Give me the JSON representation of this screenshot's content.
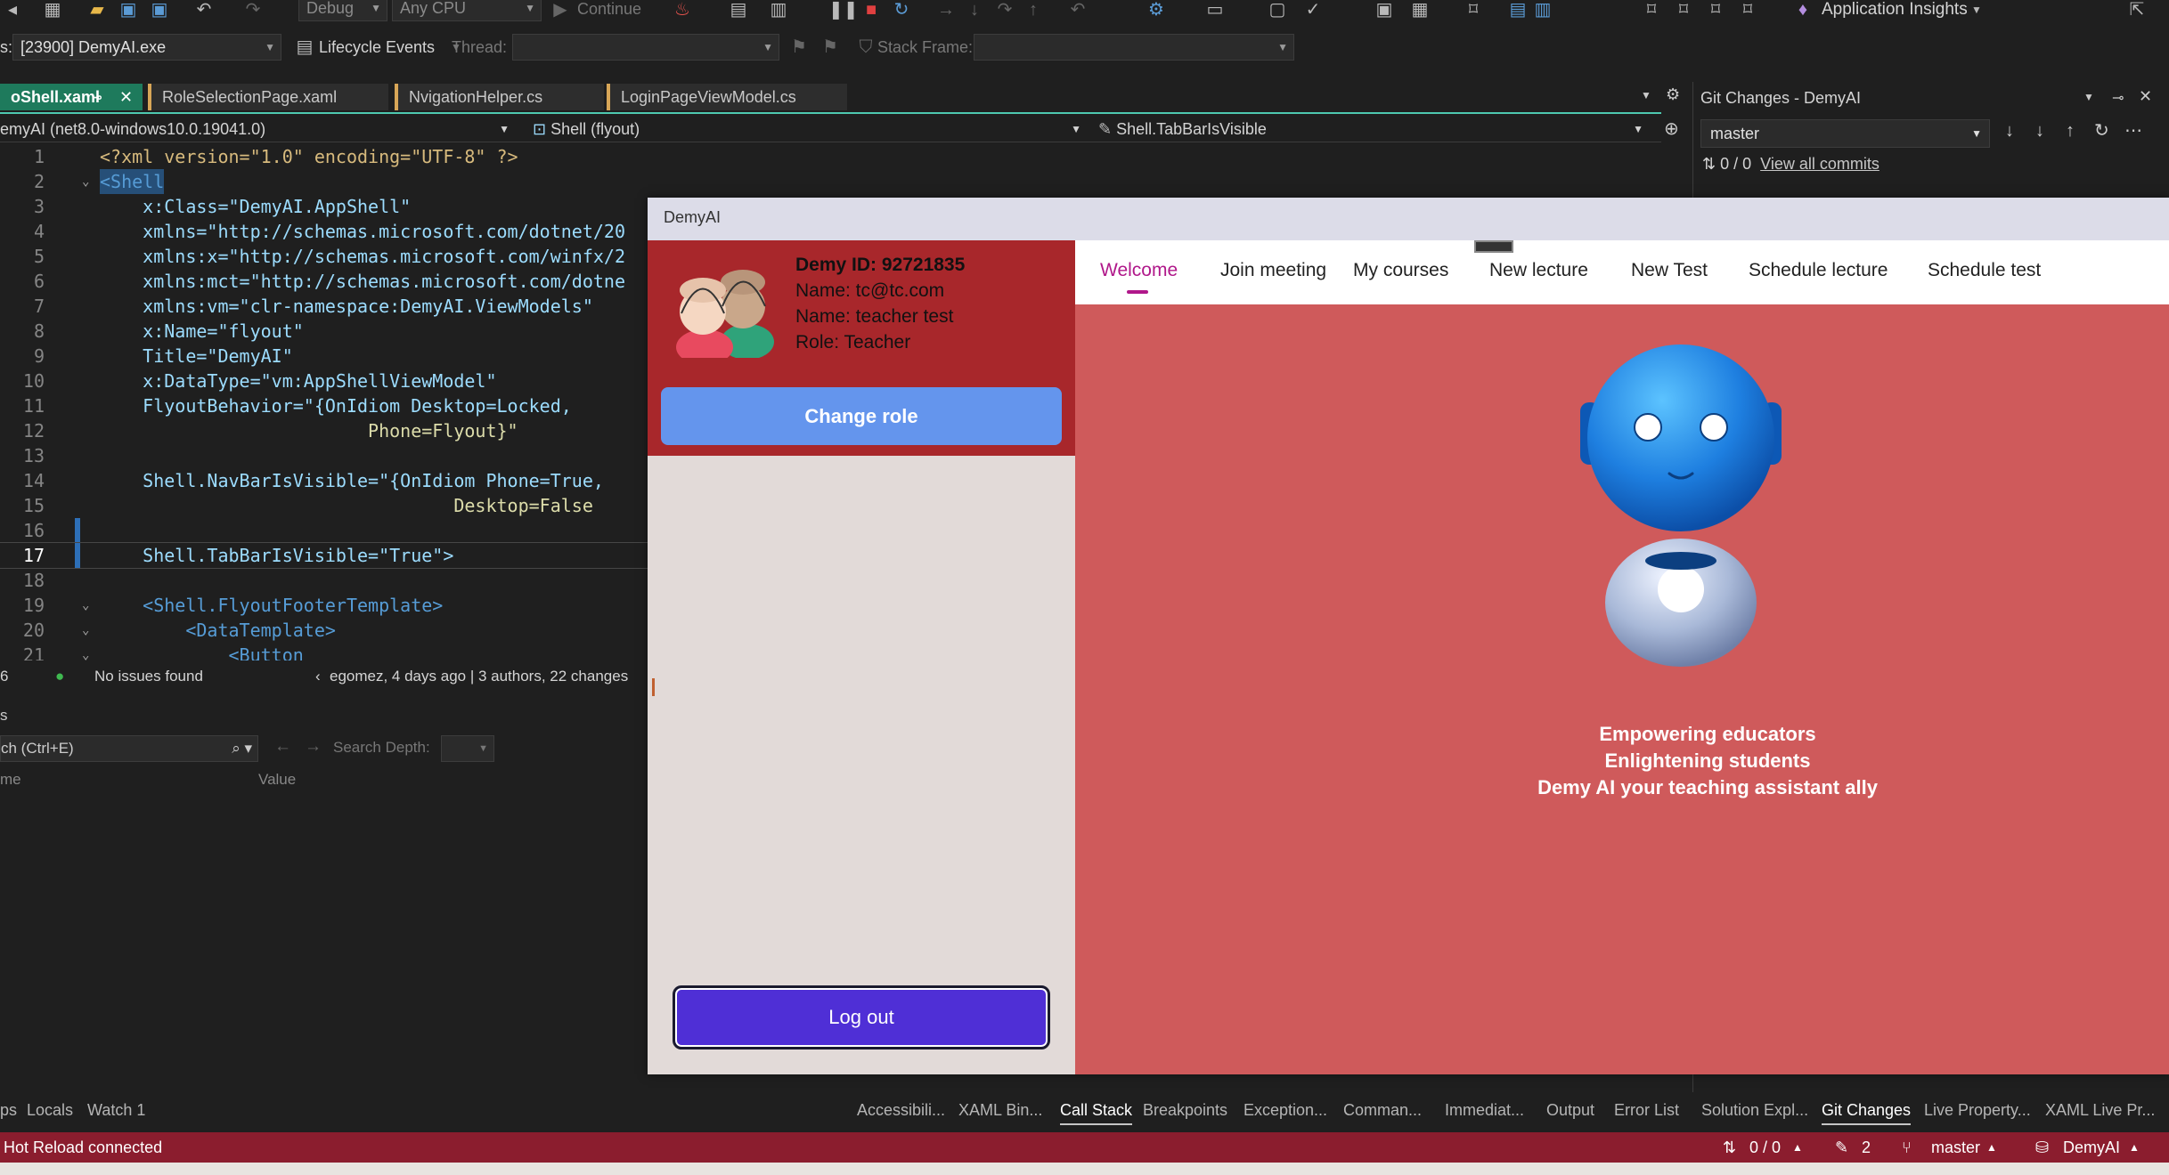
{
  "toolbar": {
    "config": "Debug",
    "platform": "Any CPU",
    "continue_label": "Continue",
    "app_insights_label": "Application Insights",
    "process_label": "s:",
    "process": "[23900] DemyAI.exe",
    "lifecycle_label": "Lifecycle Events",
    "thread_label": "Thread:",
    "stack_frame_label": "Stack Frame:"
  },
  "editor_tabs": [
    {
      "label": "oShell.xaml",
      "active": true
    },
    {
      "label": "RoleSelectionPage.xaml"
    },
    {
      "label": "NvigationHelper.cs"
    },
    {
      "label": "LoginPageViewModel.cs"
    }
  ],
  "navbar": {
    "project": "emyAI (net8.0-windows10.0.19041.0)",
    "scope": "Shell (flyout)",
    "member": "Shell.TabBarIsVisible"
  },
  "code_lines": [
    {
      "n": "1",
      "text": "<?xml version=\"1.0\" encoding=\"UTF-8\" ?>"
    },
    {
      "n": "2",
      "text": "<Shell"
    },
    {
      "n": "3",
      "text": "    x:Class=\"DemyAI.AppShell\""
    },
    {
      "n": "4",
      "text": "    xmlns=\"http://schemas.microsoft.com/dotnet/20"
    },
    {
      "n": "5",
      "text": "    xmlns:x=\"http://schemas.microsoft.com/winfx/2"
    },
    {
      "n": "6",
      "text": "    xmlns:mct=\"http://schemas.microsoft.com/dotne"
    },
    {
      "n": "7",
      "text": "    xmlns:vm=\"clr-namespace:DemyAI.ViewModels\""
    },
    {
      "n": "8",
      "text": "    x:Name=\"flyout\""
    },
    {
      "n": "9",
      "text": "    Title=\"DemyAI\""
    },
    {
      "n": "10",
      "text": "    x:DataType=\"vm:AppShellViewModel\""
    },
    {
      "n": "11",
      "text": "    FlyoutBehavior=\"{OnIdiom Desktop=Locked,"
    },
    {
      "n": "12",
      "text": "                         Phone=Flyout}\""
    },
    {
      "n": "13",
      "text": ""
    },
    {
      "n": "14",
      "text": "    Shell.NavBarIsVisible=\"{OnIdiom Phone=True,"
    },
    {
      "n": "15",
      "text": "                                 Desktop=False"
    },
    {
      "n": "16",
      "text": ""
    },
    {
      "n": "17",
      "text": "    Shell.TabBarIsVisible=\"True\">"
    },
    {
      "n": "18",
      "text": ""
    },
    {
      "n": "19",
      "text": "    <Shell.FlyoutFooterTemplate>"
    },
    {
      "n": "20",
      "text": "        <DataTemplate>"
    },
    {
      "n": "21",
      "text": "            <Button"
    }
  ],
  "editor_status": {
    "zoom": "6",
    "issues": "No issues found",
    "blame": "egomez, 4 days ago | 3 authors, 22 changes"
  },
  "locals": {
    "title": "s",
    "search_placeholder": "ch (Ctrl+E)",
    "search_depth_label": "Search Depth:",
    "col_name": "me",
    "col_value": "Value"
  },
  "bottom_tabs": {
    "left": [
      "ps",
      "Locals",
      "Watch 1"
    ],
    "right": [
      "Accessibili...",
      "XAML Bin...",
      "Call Stack",
      "Breakpoints",
      "Exception...",
      "Comman...",
      "Immediat...",
      "Output",
      "Error List",
      "Solution Expl...",
      "Git Changes",
      "Live Property...",
      "XAML Live Pr..."
    ]
  },
  "statusbar": {
    "left": "Hot Reload connected",
    "commits": "0 / 0",
    "edits": "2",
    "branch": "master",
    "project": "DemyAI"
  },
  "git_panel": {
    "title": "Git Changes - DemyAI",
    "branch": "master",
    "counts": "0 / 0",
    "view_commits": "View all commits"
  },
  "app": {
    "title": "DemyAI",
    "user": {
      "id_line": "Demy ID: 92721835",
      "email_line": "Name: tc@tc.com",
      "name_line": "Name: teacher test",
      "role_line": "Role: Teacher"
    },
    "change_role": "Change role",
    "logout": "Log out",
    "tabs": [
      "Welcome",
      "Join meeting",
      "My courses",
      "New lecture",
      "New Test",
      "Schedule lecture",
      "Schedule test"
    ],
    "active_tab": "Welcome",
    "taglines": [
      "Empowering educators",
      "Enlightening students",
      "Demy AI your teaching assistant ally"
    ],
    "colors": {
      "flyout_header": "#a8272b",
      "content_bg": "#cf5a5b",
      "change_role_btn": "#6495ed",
      "logout_btn": "#4f2fd6",
      "active_tab": "#b0188a"
    }
  }
}
